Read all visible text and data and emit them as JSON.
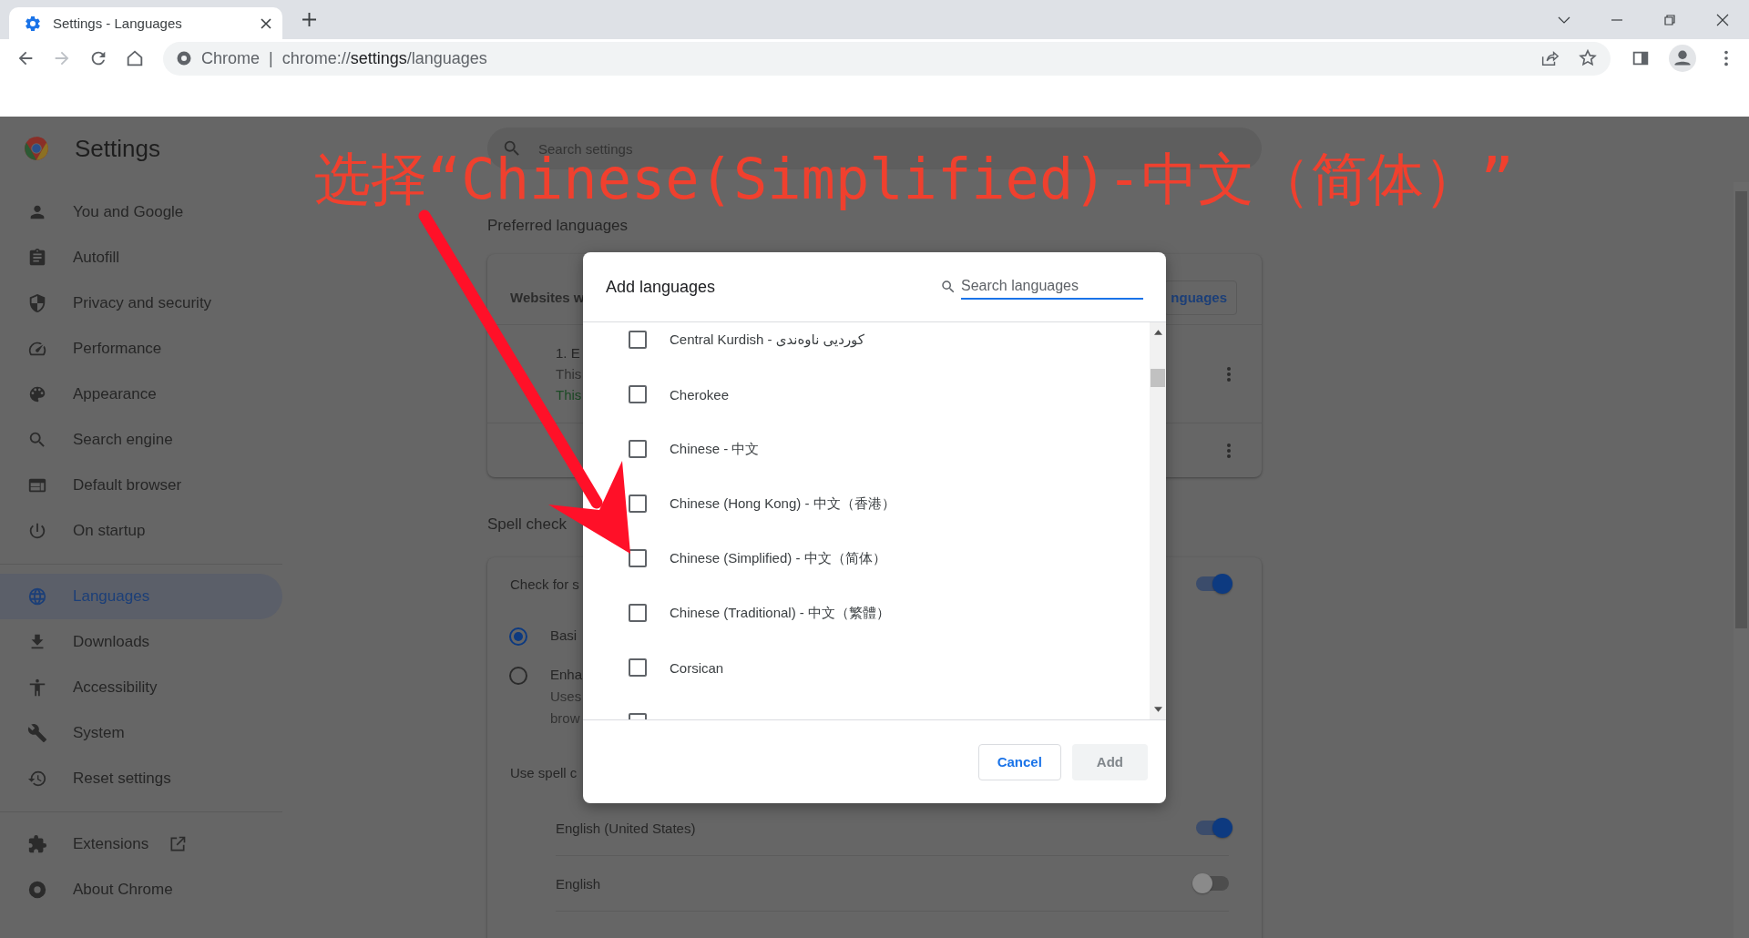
{
  "browser": {
    "tab": {
      "title": "Settings - Languages"
    },
    "omnibox": {
      "chip": "Chrome",
      "separator": "|",
      "url_scheme": "chrome://",
      "url_host": "settings",
      "url_path": "/languages"
    }
  },
  "header": {
    "title": "Settings",
    "search_placeholder": "Search settings"
  },
  "annotation": {
    "text": "选择“Chinese(Simplified)-中文（简体）”"
  },
  "sidebar": {
    "groups": [
      [
        {
          "label": "You and Google",
          "selected": false
        },
        {
          "label": "Autofill",
          "selected": false
        },
        {
          "label": "Privacy and security",
          "selected": false
        },
        {
          "label": "Performance",
          "selected": false
        },
        {
          "label": "Appearance",
          "selected": false
        },
        {
          "label": "Search engine",
          "selected": false
        },
        {
          "label": "Default browser",
          "selected": false
        },
        {
          "label": "On startup",
          "selected": false
        }
      ],
      [
        {
          "label": "Languages",
          "selected": true
        },
        {
          "label": "Downloads",
          "selected": false
        },
        {
          "label": "Accessibility",
          "selected": false
        },
        {
          "label": "System",
          "selected": false
        },
        {
          "label": "Reset settings",
          "selected": false
        }
      ],
      [
        {
          "label": "Extensions",
          "selected": false,
          "external": true
        },
        {
          "label": "About Chrome",
          "selected": false,
          "external": false
        }
      ]
    ]
  },
  "preferred_languages": {
    "heading": "Preferred languages",
    "card_label": "Websites w",
    "button": "nguages",
    "rows": [
      {
        "lines": [
          {
            "text": "1. E",
            "kind": "title"
          },
          {
            "text": "This",
            "kind": "note"
          },
          {
            "text": "This",
            "kind": "status"
          }
        ],
        "menu": true
      },
      {
        "menu": true
      }
    ]
  },
  "spell_check": {
    "heading": "Spell check",
    "toggle_label": "Check for s",
    "on": true,
    "options": [
      {
        "label": "Basi",
        "selected": true
      },
      {
        "label": "Enha",
        "lines": [
          "Uses",
          "brow"
        ],
        "selected": false
      }
    ],
    "use_label": "Use spell c",
    "languages": [
      {
        "name": "English (United States)",
        "on": true
      },
      {
        "name": "English",
        "on": false
      }
    ]
  },
  "dialog": {
    "title": "Add languages",
    "search_placeholder": "Search languages",
    "languages": [
      {
        "label": "Central Kurdish - کوردیی ناوەندی",
        "checked": false
      },
      {
        "label": "Cherokee",
        "checked": false
      },
      {
        "label": "Chinese - 中文",
        "checked": false
      },
      {
        "label": "Chinese (Hong Kong) - 中文（香港）",
        "checked": false
      },
      {
        "label": "Chinese (Simplified) - 中文（简体）",
        "checked": false
      },
      {
        "label": "Chinese (Traditional) - 中文（繁體）",
        "checked": false
      },
      {
        "label": "Corsican",
        "checked": false
      },
      {
        "checked": false
      }
    ],
    "cancel": "Cancel",
    "add": {
      "label": "Add",
      "disabled": true
    }
  }
}
